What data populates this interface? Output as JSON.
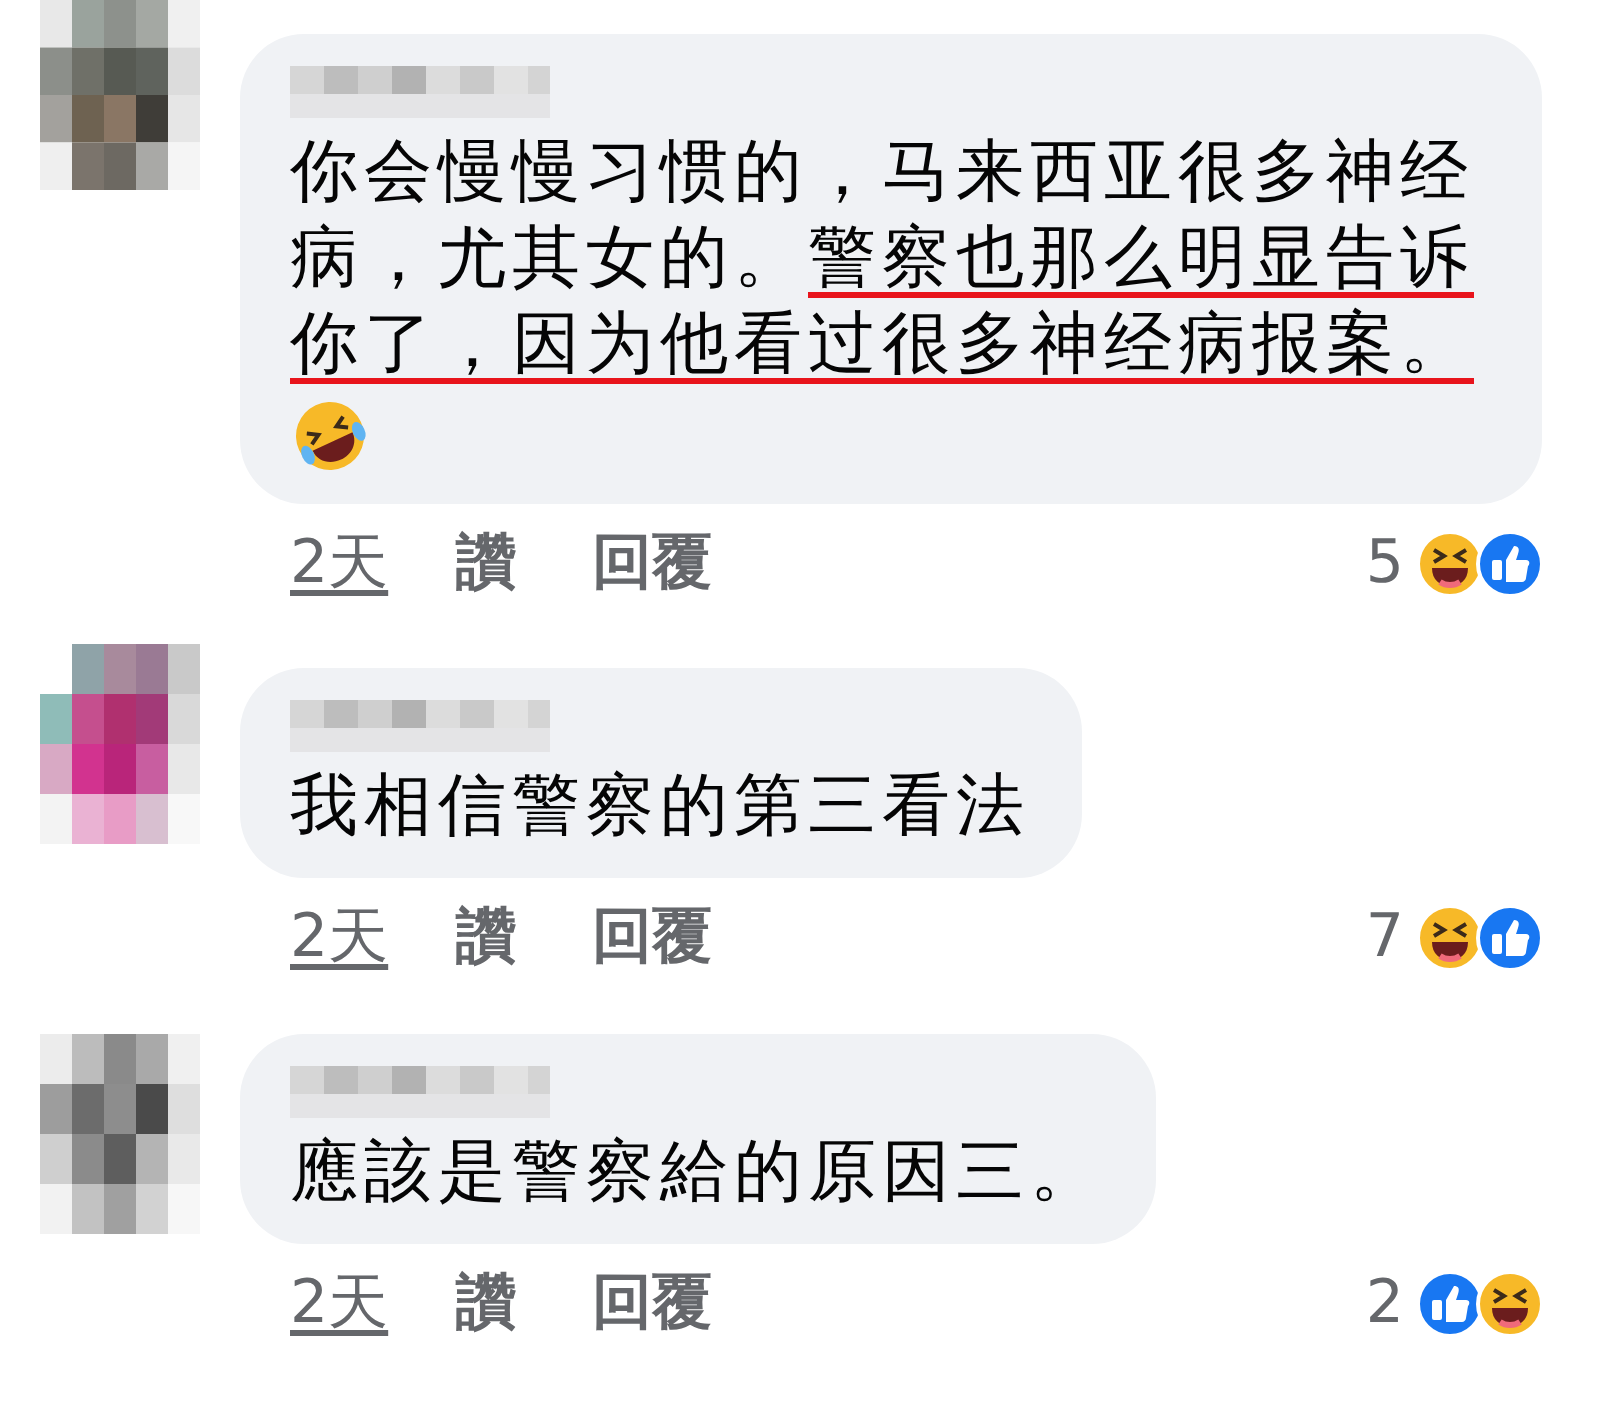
{
  "comments": [
    {
      "segments": [
        {
          "text": "你会慢慢习惯的，马来西亚很多神经病，尤其女的。",
          "underlined": false
        },
        {
          "text": "警察也那么明显告诉你了，因为他看过很多神经病报案。",
          "underlined": true
        }
      ],
      "emoji_line": true,
      "time": "2天",
      "like": "讚",
      "reply": "回覆",
      "reaction_count": "5",
      "reactions": [
        {
          "kind": "haha"
        },
        {
          "kind": "like"
        }
      ]
    },
    {
      "segments": [
        {
          "text": "我相信警察的第三看法",
          "underlined": false
        }
      ],
      "emoji_line": false,
      "time": "2天",
      "like": "讚",
      "reply": "回覆",
      "reaction_count": "7",
      "reactions": [
        {
          "kind": "haha"
        },
        {
          "kind": "like"
        }
      ]
    },
    {
      "segments": [
        {
          "text": "應該是警察給的原因三。",
          "underlined": false
        }
      ],
      "emoji_line": false,
      "time": "2天",
      "like": "讚",
      "reply": "回覆",
      "reaction_count": "2",
      "reactions": [
        {
          "kind": "like"
        },
        {
          "kind": "haha"
        }
      ]
    }
  ]
}
